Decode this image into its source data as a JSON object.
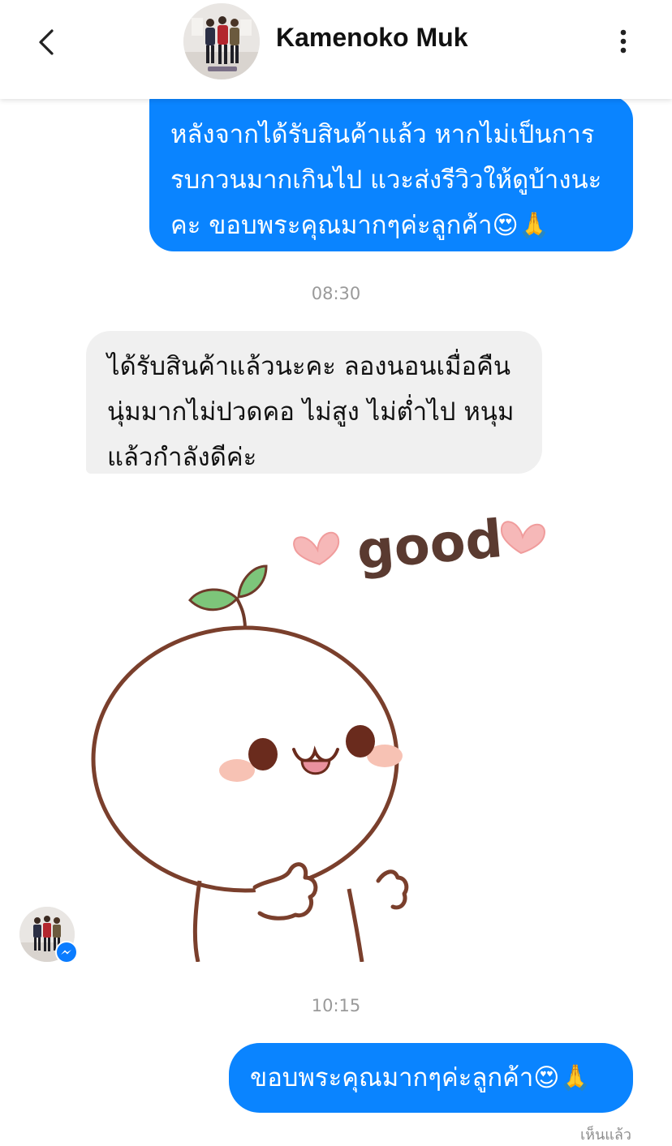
{
  "header": {
    "title": "Kamenoko Muk"
  },
  "messages": [
    {
      "text": "หลังจากได้รับสินค้าแล้ว หากไม่เป็นการ\nรบกวนมากเกินไป แวะส่งรีวิวให้ดูบ้างนะ\nคะ ขอบพระคุณมากๆค่ะลูกค้า😍🙏"
    },
    {
      "text": "ได้รับสินค้าแล้วนะคะ ลองนอนเมื่อคืน\nนุ่มมากไม่ปวดคอ ไม่สูง ไม่ต่ำไป หนุม\nแล้วกำลังดีค่ะ"
    },
    {
      "text": "ขอบพระคุณมากๆค่ะลูกค้า😍🙏"
    }
  ],
  "timestamps": [
    "08:30",
    "10:15"
  ],
  "sticker": {
    "word": "good"
  },
  "status": {
    "seen": "เห็นแล้ว"
  },
  "colors": {
    "outgoing_bubble": "#0a84ff",
    "incoming_bubble": "#f0f0f0",
    "messenger_badge": "#0a7cff"
  },
  "icons": {
    "back": "chevron-left-icon",
    "menu": "more-vertical-icon",
    "badge": "messenger-icon"
  }
}
